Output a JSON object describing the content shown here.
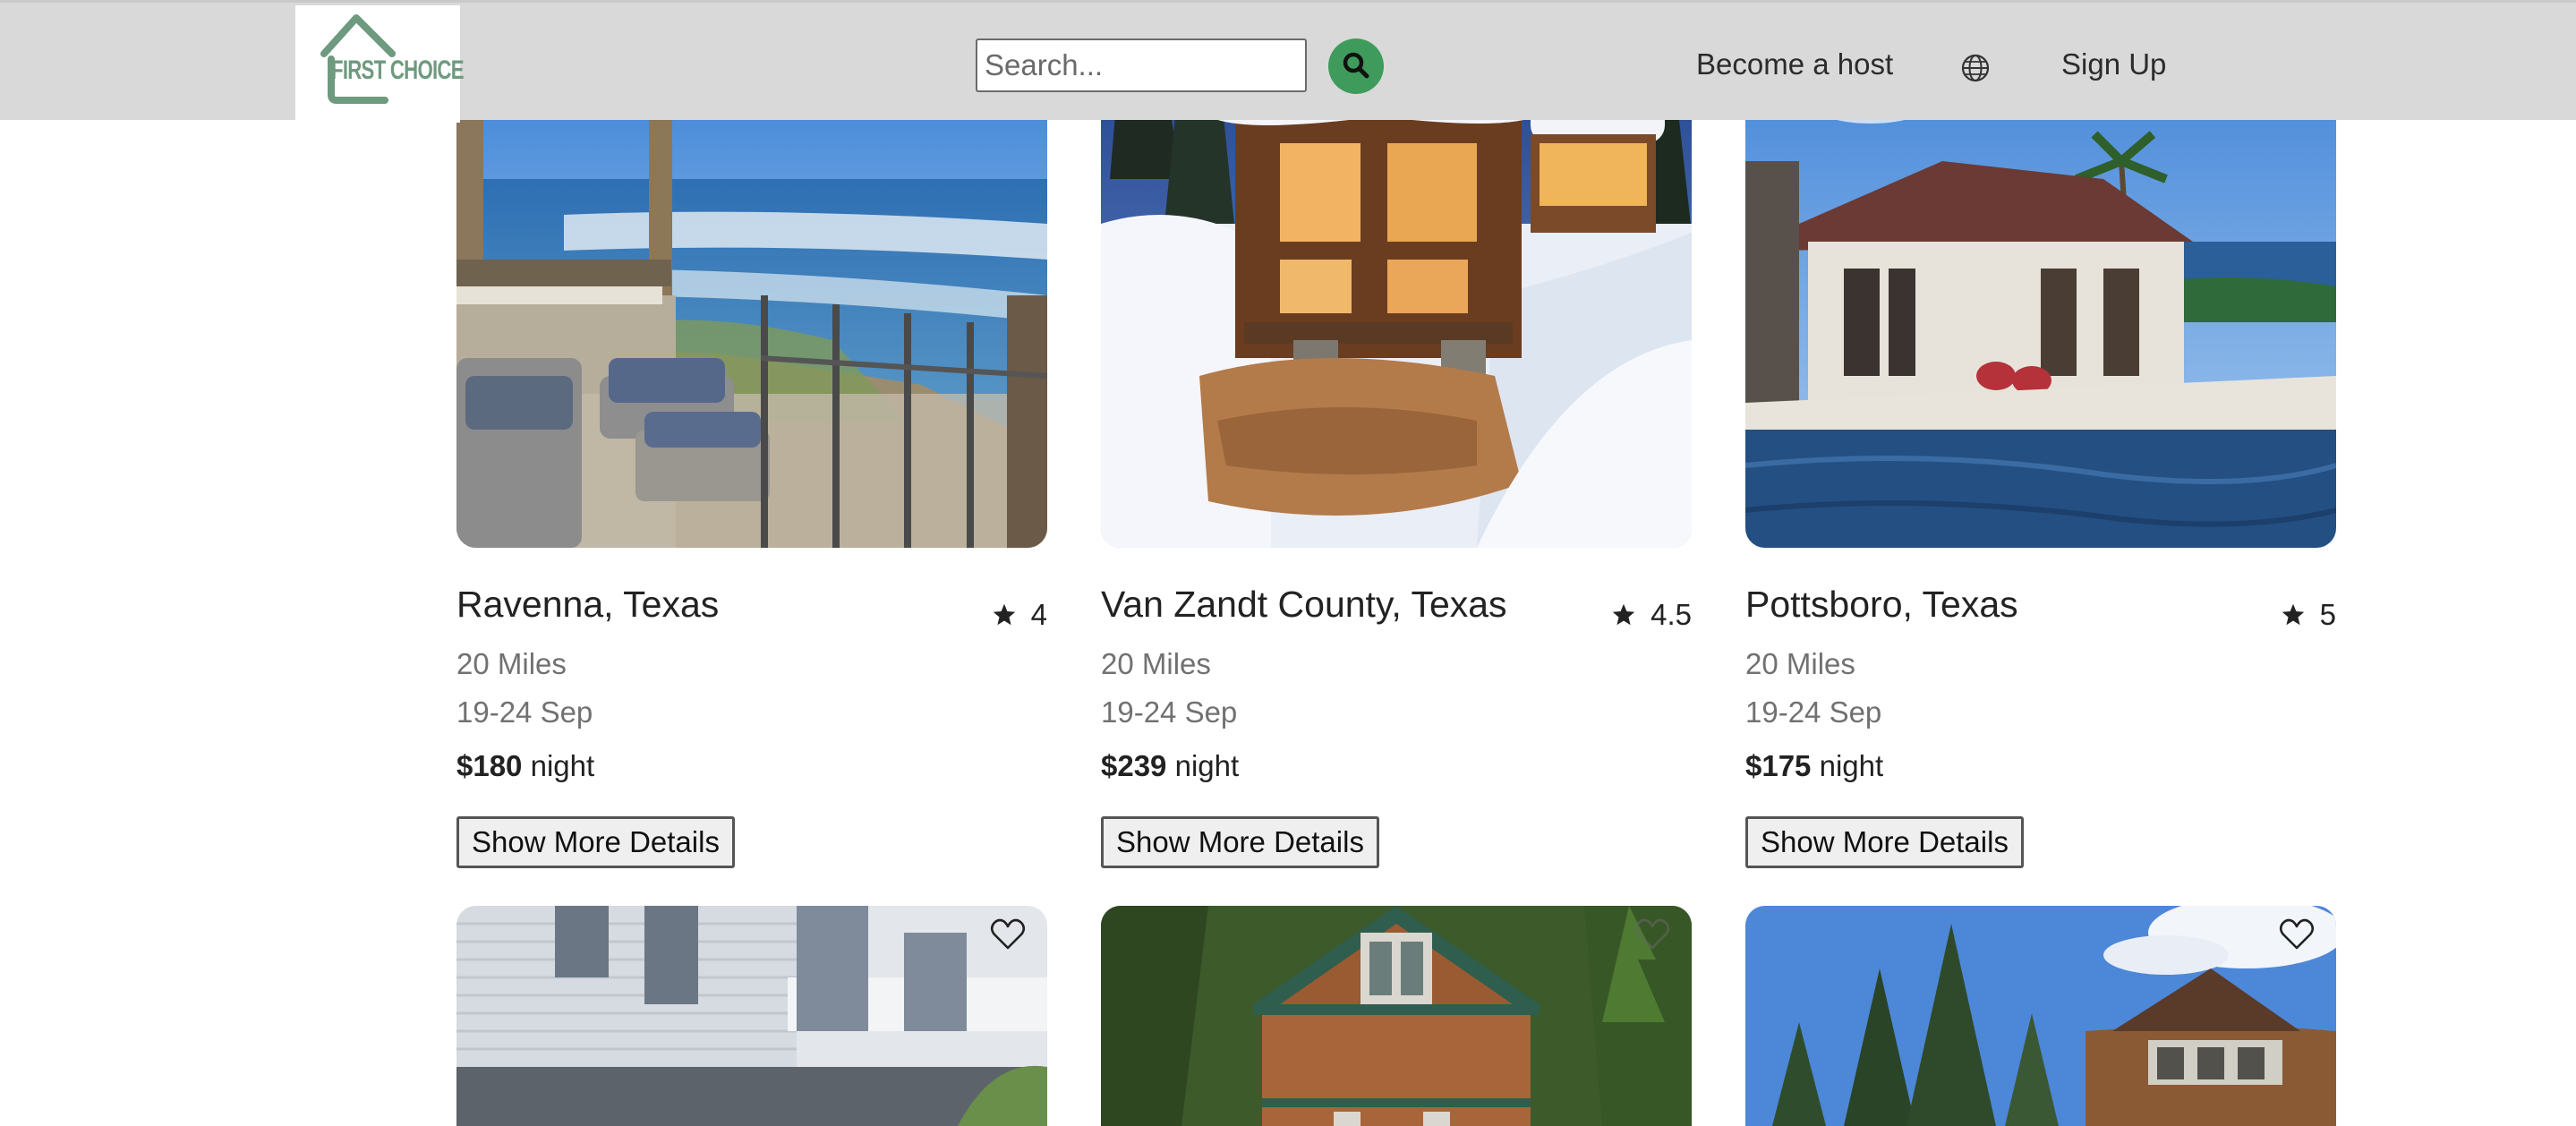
{
  "header": {
    "logo_text": "FIRST CHOICE",
    "search_placeholder": "Search...",
    "search_value": "",
    "become_host_label": "Become a host",
    "sign_up_label": "Sign Up"
  },
  "listings": [
    {
      "location": "Ravenna, Texas",
      "rating": "4",
      "distance": "20 Miles",
      "dates": "19-24 Sep",
      "price": "$180",
      "price_unit": "night",
      "details_label": "Show More Details"
    },
    {
      "location": "Van Zandt County, Texas",
      "rating": "4.5",
      "distance": "20 Miles",
      "dates": "19-24 Sep",
      "price": "$239",
      "price_unit": "night",
      "details_label": "Show More Details"
    },
    {
      "location": "Pottsboro, Texas",
      "rating": "5",
      "distance": "20 Miles",
      "dates": "19-24 Sep",
      "price": "$175",
      "price_unit": "night",
      "details_label": "Show More Details"
    }
  ],
  "icons": {
    "search": "search-icon",
    "globe": "globe-icon",
    "star": "star-icon",
    "heart": "heart-icon",
    "prev": "chevron-left-icon",
    "next": "chevron-right-icon"
  },
  "colors": {
    "header_bg": "#d9d9d9",
    "search_button": "#3f9b5b",
    "logo_green": "#6e9a7f"
  }
}
